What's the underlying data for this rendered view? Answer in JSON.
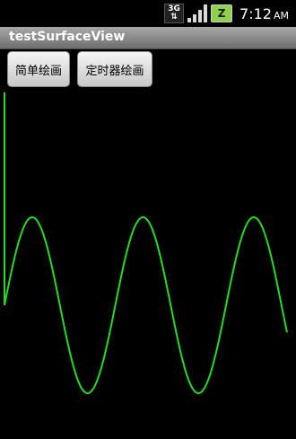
{
  "status_bar": {
    "network_label": "3G",
    "battery_label": "Z",
    "time": "7:12",
    "ampm": "AM"
  },
  "app": {
    "title": "testSurfaceView"
  },
  "buttons": {
    "simple_draw": "简单绘画",
    "timer_draw": "定时器绘画"
  },
  "surface": {
    "background": "#000000",
    "line_color": "#22dd22",
    "wave_periods_shown": 2.55
  }
}
